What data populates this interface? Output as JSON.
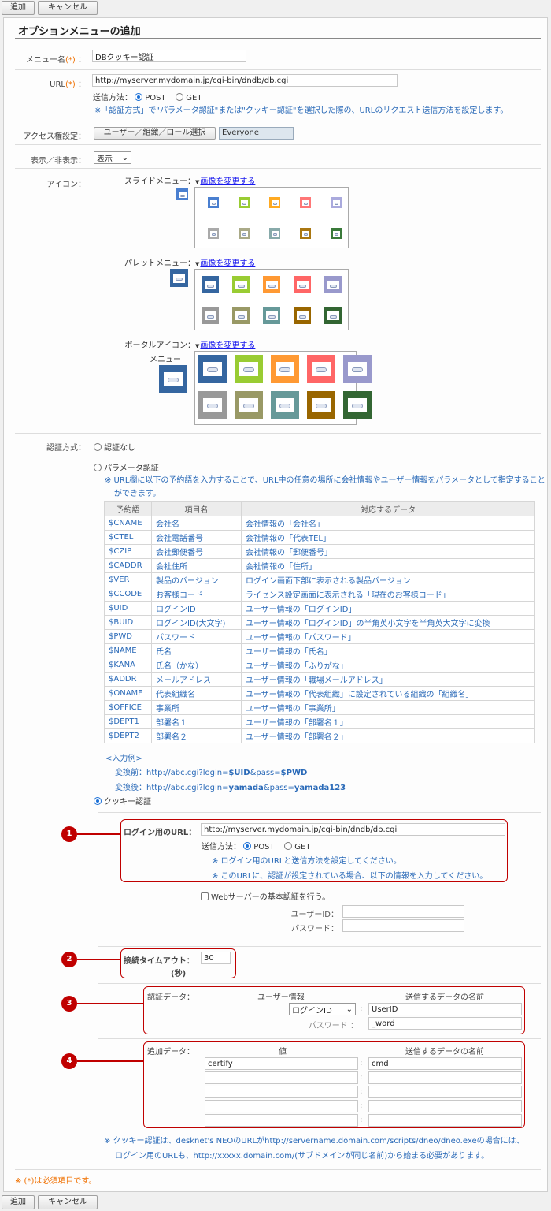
{
  "toolbar": {
    "add_label": "追加",
    "cancel_label": "キャンセル"
  },
  "page_title": "オプションメニューの追加",
  "menu_name": {
    "label": "メニュー名",
    "req": "(*)",
    "sep": "：",
    "value": "DBクッキー認証"
  },
  "url": {
    "label": "URL",
    "req": "(*)",
    "sep": "：",
    "value": "http://myserver.mydomain.jp/cgi-bin/dndb/db.cgi",
    "method_label": "送信方法：",
    "post": "POST",
    "get": "GET",
    "selected": "POST",
    "note": "※「認証方式」で\"パラメータ認証\"または\"クッキー認証\"を選択した際の、URLのリクエスト送信方法を設定します。"
  },
  "access": {
    "label": "アクセス権設定：",
    "button": "ユーザー／組織／ロール選択",
    "value": "Everyone"
  },
  "visibility": {
    "label": "表示／非表示：",
    "value": "表示"
  },
  "icon": {
    "label": "アイコン：",
    "change_link": "画像を変更する",
    "slide_label": "スライドメニュー：",
    "palette_label": "パレットメニュー：",
    "portal_label": "ポータルアイコン：",
    "portal_label2": "メニュー",
    "colors": [
      "#3566a0",
      "#99cc33",
      "#ff9933",
      "#ff6666",
      "#9999cc",
      "#999999",
      "#999966",
      "#669999",
      "#996600",
      "#336633"
    ],
    "slide_colors": [
      "#4a7fd0",
      "#99cc33",
      "#ffaa22",
      "#ff7777",
      "#aaaadd",
      "#aaaaaa",
      "#aaaa88",
      "#88aaaa",
      "#aa7711",
      "#3a7a3a"
    ],
    "selected_color": "#3566a0"
  },
  "auth": {
    "label": "認証方式：",
    "none": "認証なし",
    "param": "パラメータ認証",
    "param_note": "※ URL欄に以下の予約語を入力することで、URL中の任意の場所に会社情報やユーザー情報をパラメータとして指定することができます。",
    "table_headers": [
      "予約語",
      "項目名",
      "対応するデータ"
    ],
    "table_rows": [
      [
        "$CNAME",
        "会社名",
        "会社情報の「会社名」"
      ],
      [
        "$CTEL",
        "会社電話番号",
        "会社情報の「代表TEL」"
      ],
      [
        "$CZIP",
        "会社郵便番号",
        "会社情報の「郵便番号」"
      ],
      [
        "$CADDR",
        "会社住所",
        "会社情報の「住所」"
      ],
      [
        "$VER",
        "製品のバージョン",
        "ログイン画面下部に表示される製品バージョン"
      ],
      [
        "$CCODE",
        "お客様コード",
        "ライセンス設定画面に表示される「現在のお客様コード」"
      ],
      [
        "$UID",
        "ログインID",
        "ユーザー情報の「ログインID」"
      ],
      [
        "$BUID",
        "ログインID(大文字)",
        "ユーザー情報の「ログインID」の半角英小文字を半角英大文字に変換"
      ],
      [
        "$PWD",
        "パスワード",
        "ユーザー情報の「パスワード」"
      ],
      [
        "$NAME",
        "氏名",
        "ユーザー情報の「氏名」"
      ],
      [
        "$KANA",
        "氏名（かな）",
        "ユーザー情報の「ふりがな」"
      ],
      [
        "$ADDR",
        "メールアドレス",
        "ユーザー情報の「職場メールアドレス」"
      ],
      [
        "$ONAME",
        "代表組織名",
        "ユーザー情報の「代表組織」に設定されている組織の「組織名」"
      ],
      [
        "$OFFICE",
        "事業所",
        "ユーザー情報の「事業所」"
      ],
      [
        "$DEPT1",
        "部署名１",
        "ユーザー情報の「部署名１」"
      ],
      [
        "$DEPT2",
        "部署名２",
        "ユーザー情報の「部署名２」"
      ]
    ],
    "example_label": "<入力例>",
    "before_prefix": "変換前：http://abc.cgi?login=",
    "before_b1": "$UID",
    "before_mid": "&pass=",
    "before_b2": "$PWD",
    "after_prefix": "変換後：http://abc.cgi?login=",
    "after_b1": "yamada",
    "after_mid": "&pass=",
    "after_b2": "yamada123",
    "cookie": "クッキー認証",
    "selected": "cookie"
  },
  "cookie": {
    "login_url_label": "ログイン用のURL：",
    "login_url": "http://myserver.mydomain.jp/cgi-bin/dndb/db.cgi",
    "method_label": "送信方法：",
    "post": "POST",
    "get": "GET",
    "selected": "POST",
    "note1": "※ ログイン用のURLと送信方法を設定してください。",
    "note2": "※ このURLに、認証が設定されている場合、以下の情報を入力してください。",
    "basic_auth": "Webサーバーの基本認証を行う。",
    "userid_label": "ユーザーID：",
    "userid": "",
    "password_label": "パスワード：",
    "password": "",
    "timeout_label": "接続タイムアウト：",
    "timeout_unit": "(秒)",
    "timeout": "30",
    "authdata_label": "認証データ：",
    "authdata_col1": "ユーザー情報",
    "authdata_col2": "送信するデータの名前",
    "authdata_select": "ログインID",
    "authdata_name1": "UserID",
    "authdata_pw_label": "パスワード",
    "authdata_name2": "_word",
    "extra_label": "追加データ：",
    "extra_col1": "値",
    "extra_col2": "送信するデータの名前",
    "extra_rows": [
      [
        "certify",
        "cmd"
      ],
      [
        "",
        ""
      ],
      [
        "",
        ""
      ],
      [
        "",
        ""
      ],
      [
        "",
        ""
      ]
    ],
    "footer_note1": "※ クッキー認証は、desknet's NEOのURLがhttp://servername.domain.com/scripts/dneo/dneo.exeの場合には、",
    "footer_note2": "ログイン用のURLも、http://xxxxx.domain.com/(サブドメインが同じ名前)から始まる必要があります。"
  },
  "markers": [
    "1",
    "2",
    "3",
    "4"
  ],
  "required_note": "※ (*)は必須項目です。"
}
